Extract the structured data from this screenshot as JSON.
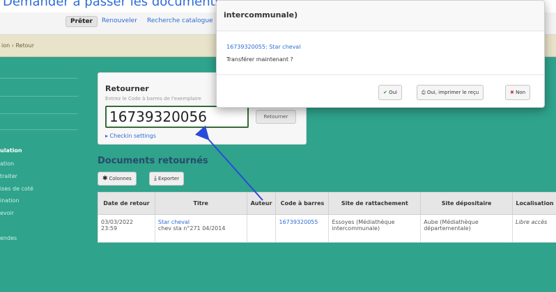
{
  "caption": {
    "text": "Demander à passer les documents du retour ?"
  },
  "toolbar": {
    "preter": "Prêter",
    "renouveler": "Renouveler",
    "recherche": "Recherche catalogue"
  },
  "breadcrumb": {
    "text": "ion › Retour"
  },
  "sidebar": {
    "items": [
      {
        "label": "ulation",
        "kind": "head"
      },
      {
        "label": "ation"
      },
      {
        "label": "traiter"
      },
      {
        "label": "ises de coté"
      },
      {
        "label": "ination"
      },
      {
        "label": "evoir"
      },
      {
        "label": "endes"
      }
    ]
  },
  "return_form": {
    "title": "Retourner",
    "hint": "Entrez le Code à barres de l'exemplaire",
    "barcode_value": "16739320056",
    "submit_label": "Retourner",
    "checkin_settings": "▸ Checkin settings"
  },
  "returned": {
    "title": "Documents retournés",
    "columns_button": "Colonnes",
    "export_button": "Exporter",
    "headers": [
      "Date de retour",
      "Titre",
      "Auteur",
      "Code à barres",
      "Site de rattachement",
      "Site dépositaire",
      "Localisation"
    ],
    "rows": [
      {
        "date_line1": "03/03/2022",
        "date_line2": "23:59",
        "title": "Star cheval",
        "subtitle": "chev sta n°271 04/2014",
        "author": "",
        "barcode": "16739320055",
        "home_line1": "Essoyes (Médiathèque",
        "home_line2": "intercommunale)",
        "holding_line1": "Aube (Médiathèque",
        "holding_line2": "départementale)",
        "location": "Libre accès"
      }
    ]
  },
  "modal": {
    "title": "intercommunale)",
    "item": "16739320055: Star cheval",
    "question": "Transférer maintenant ?",
    "yes": "Oui",
    "yes_print": "Oui, imprimer le reçu",
    "no": "Non"
  },
  "colors": {
    "background": "#2fa38c",
    "link": "#2e6bd6",
    "arrow": "#2a4bd9"
  }
}
